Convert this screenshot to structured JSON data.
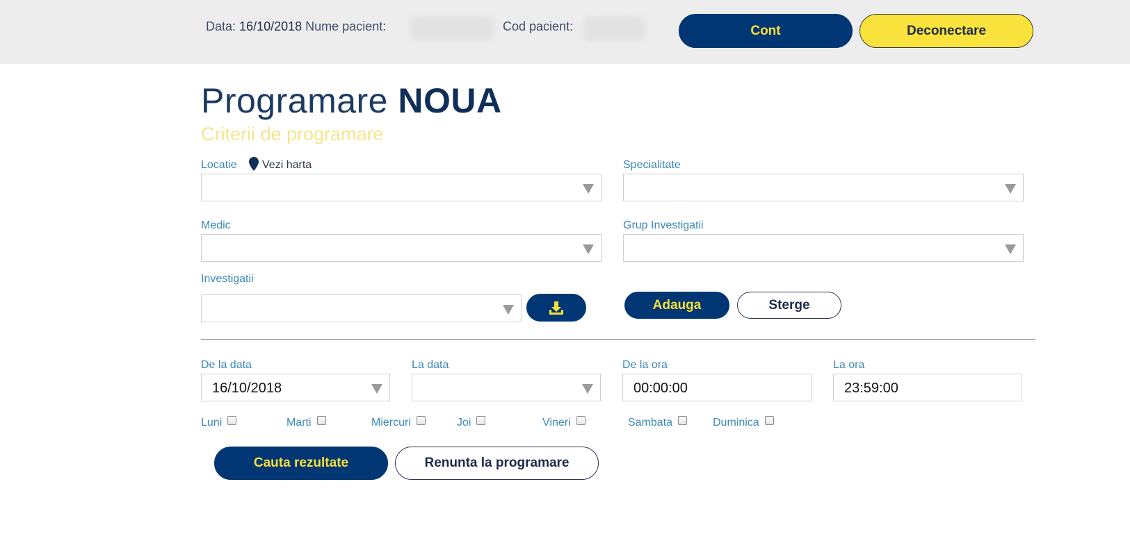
{
  "header": {
    "date_label": "Data:",
    "date_value": "16/10/2018",
    "patient_name_label": "Nume pacient:",
    "patient_code_label": "Cod pacient:",
    "account_button": "Cont",
    "logout_button": "Deconectare"
  },
  "page": {
    "title_light": "Programare",
    "title_bold": "NOUA",
    "subtitle": "Criterii de programare"
  },
  "form": {
    "location_label": "Locatie",
    "map_link": "Vezi harta",
    "specialty_label": "Specialitate",
    "doctor_label": "Medic",
    "investigation_group_label": "Grup Investigatii",
    "investigations_label": "Investigatii",
    "add_button": "Adauga",
    "delete_button": "Sterge",
    "from_date_label": "De la data",
    "from_date_value": "16/10/2018",
    "to_date_label": "La data",
    "to_date_value": "",
    "from_time_label": "De la ora",
    "from_time_value": "00:00:00",
    "to_time_label": "La ora",
    "to_time_value": "23:59:00",
    "days": [
      {
        "label": "Luni",
        "checked": false
      },
      {
        "label": "Marti",
        "checked": false
      },
      {
        "label": "Miercuri",
        "checked": false
      },
      {
        "label": "Joi",
        "checked": false
      },
      {
        "label": "Vineri",
        "checked": false
      },
      {
        "label": "Sambata",
        "checked": false
      },
      {
        "label": "Duminica",
        "checked": false
      }
    ],
    "search_button": "Cauta rezultate",
    "cancel_button": "Renunta la programare"
  },
  "colors": {
    "navy": "#003673",
    "yellow": "#f9e33c",
    "label_blue": "#3b88b8"
  }
}
